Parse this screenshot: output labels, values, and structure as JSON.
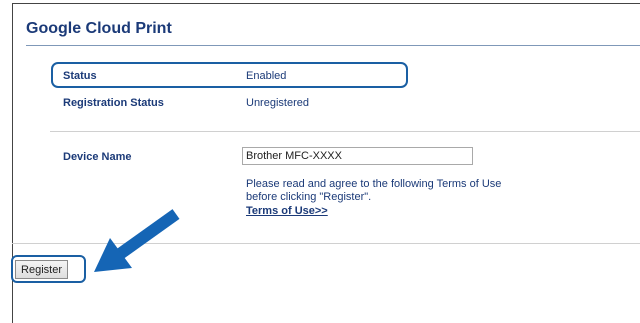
{
  "page": {
    "title": "Google Cloud Print"
  },
  "status": {
    "label": "Status",
    "value": "Enabled"
  },
  "registration": {
    "label": "Registration Status",
    "value": "Unregistered"
  },
  "device": {
    "label": "Device Name",
    "value": "Brother MFC-XXXX"
  },
  "terms": {
    "note_line1": "Please read and agree to the following Terms of Use",
    "note_line2": "before clicking \"Register\".",
    "link_label": "Terms of Use>>"
  },
  "actions": {
    "register_label": "Register"
  },
  "colors": {
    "heading": "#1b3a78",
    "highlight": "#1a5fa3",
    "arrow": "#1565b5"
  }
}
